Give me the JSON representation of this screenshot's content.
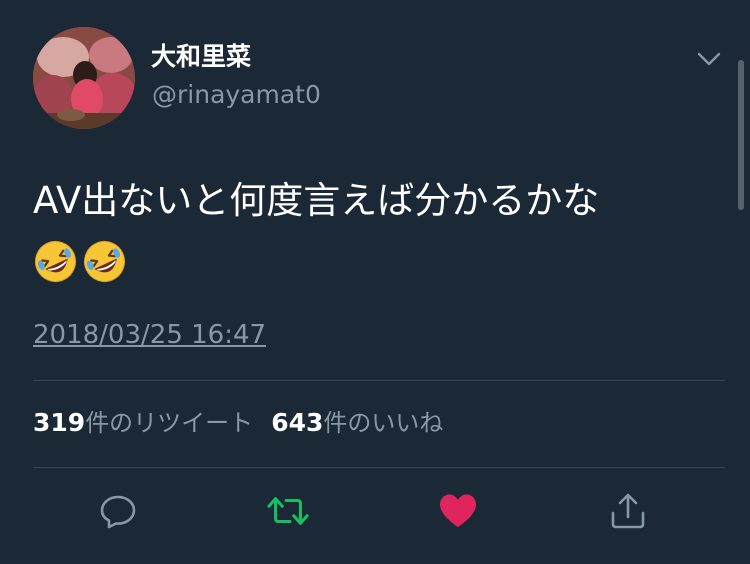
{
  "user": {
    "display_name": "大和里菜",
    "handle": "@rinayamat0",
    "avatar_icon": "profile-photo"
  },
  "tweet": {
    "text": "AV出ないと何度言えば分かるかな",
    "emojis": [
      "rolling-on-the-floor-laughing",
      "rolling-on-the-floor-laughing"
    ],
    "timestamp": "2018/03/25 16:47"
  },
  "stats": {
    "retweet_count": "319",
    "retweet_label": "件のリツイート",
    "like_count": "643",
    "like_label": "件のいいね"
  },
  "actions": {
    "reply_icon": "speech-bubble-icon",
    "retweet_icon": "retweet-arrows-icon",
    "like_icon": "heart-icon",
    "share_icon": "share-upload-icon"
  },
  "colors": {
    "background": "#1b2836",
    "secondary_text": "#8899a6",
    "retweet_active": "#17bf63",
    "like_active": "#e0245e",
    "divider": "#38444d"
  }
}
